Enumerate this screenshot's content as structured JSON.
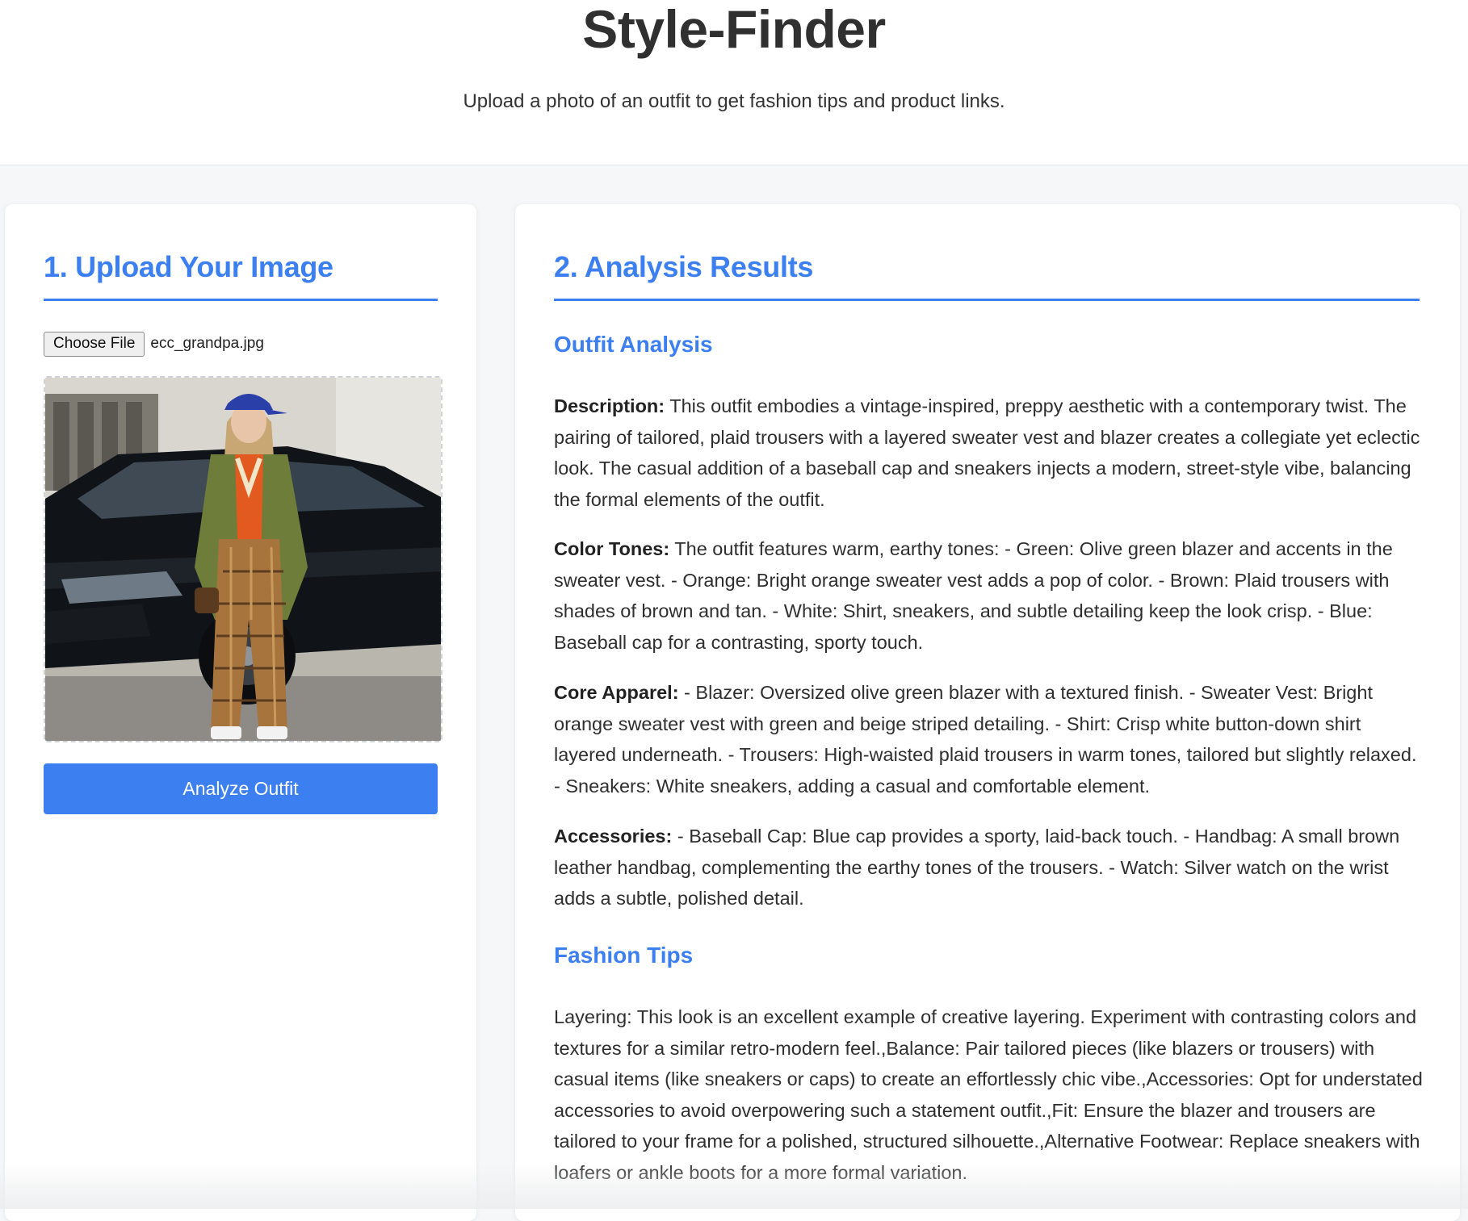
{
  "header": {
    "title": "Style-Finder",
    "subtitle": "Upload a photo of an outfit to get fashion tips and product links."
  },
  "upload": {
    "heading": "1. Upload Your Image",
    "choose_file_label": "Choose File",
    "file_name": "ecc_grandpa.jpg",
    "analyze_button": "Analyze Outfit"
  },
  "results": {
    "heading": "2. Analysis Results",
    "outfit_analysis_heading": "Outfit Analysis",
    "description_label": "Description:",
    "description_text": " This outfit embodies a vintage-inspired, preppy aesthetic with a contemporary twist. The pairing of tailored, plaid trousers with a layered sweater vest and blazer creates a collegiate yet eclectic look. The casual addition of a baseball cap and sneakers injects a modern, street-style vibe, balancing the formal elements of the outfit.",
    "color_label": "Color Tones:",
    "color_text": " The outfit features warm, earthy tones: - Green: Olive green blazer and accents in the sweater vest. - Orange: Bright orange sweater vest adds a pop of color. - Brown: Plaid trousers with shades of brown and tan. - White: Shirt, sneakers, and subtle detailing keep the look crisp. - Blue: Baseball cap for a contrasting, sporty touch.",
    "apparel_label": "Core Apparel:",
    "apparel_text": " - Blazer: Oversized olive green blazer with a textured finish. - Sweater Vest: Bright orange sweater vest with green and beige striped detailing. - Shirt: Crisp white button-down shirt layered underneath. - Trousers: High-waisted plaid trousers in warm tones, tailored but slightly relaxed. - Sneakers: White sneakers, adding a casual and comfortable element.",
    "accessories_label": "Accessories:",
    "accessories_text": " - Baseball Cap: Blue cap provides a sporty, laid-back touch. - Handbag: A small brown leather handbag, complementing the earthy tones of the trousers. - Watch: Silver watch on the wrist adds a subtle, polished detail.",
    "fashion_tips_heading": "Fashion Tips",
    "fashion_tips_text": "Layering: This look is an excellent example of creative layering. Experiment with contrasting colors and textures for a similar retro-modern feel.,Balance: Pair tailored pieces (like blazers or trousers) with casual items (like sneakers or caps) to create an effortlessly chic vibe.,Accessories: Opt for understated accessories to avoid overpowering such a statement outfit.,Fit: Ensure the blazer and trousers are tailored to your frame for a polished, structured silhouette.,Alternative Footwear: Replace sneakers with loafers or ankle boots for a more formal variation."
  },
  "colors": {
    "accent": "#3b7ff0",
    "page_bg": "#f6f7f9",
    "card_bg": "#ffffff"
  }
}
